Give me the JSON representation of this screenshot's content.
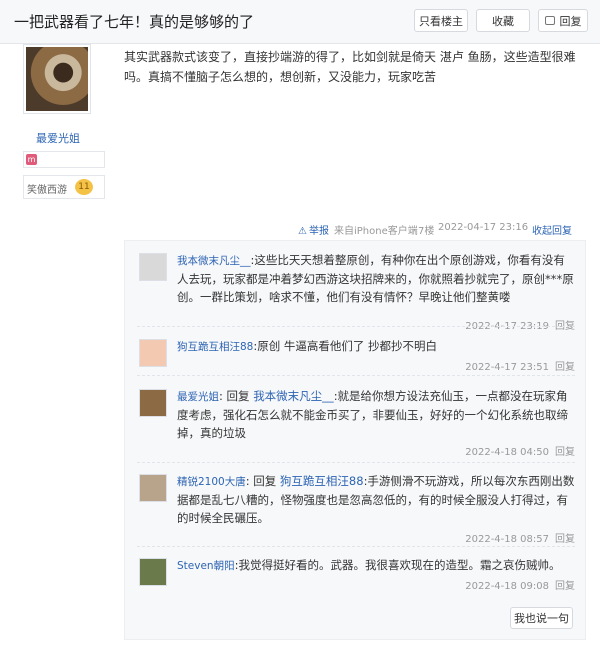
{
  "header": {
    "title": "一把武器看了七年！真的是够够的了",
    "btn_author_only": "只看楼主",
    "btn_collect": "收藏",
    "btn_reply": "回复"
  },
  "author": {
    "name": "最爱光姐",
    "level_name": "笑傲西游",
    "level_num": "11"
  },
  "post": {
    "text": "其实武器款式该变了，直接抄端游的得了，比如剑就是倚天 湛卢 鱼肠，这些造型很难吗。真搞不懂脑子怎么想的，想创新，又没能力，玩家吃苦",
    "report": "举报",
    "source": "来自iPhone客户端",
    "floor": "7楼",
    "time": "2022-04-17 23:16",
    "fold": "收起回复"
  },
  "replies": [
    {
      "user": "我本微末凡尘__",
      "prefix": ":",
      "target": "",
      "text": "这些比天天想着整原创，有种你在出个原创游戏，你看有没有人去玩，玩家都是冲着梦幻西游这块招牌来的，你就照着抄就完了，原创***原创。一群比策划，啥求不懂，他们有没有情怀？早晚让他们整黄喽",
      "time": "2022-4-17 23:19",
      "reply_label": "回复"
    },
    {
      "user": "狗互跪互相汪88",
      "prefix": ":",
      "target": "",
      "text": "原创 牛逼高看他们了 抄都抄不明白",
      "time": "2022-4-17 23:51",
      "reply_label": "回复"
    },
    {
      "user": "最爱光姐",
      "prefix": ": 回复 ",
      "target": "我本微末凡尘__",
      "text": ":就是给你想方设法充仙玉，一点都没在玩家角度考虑，强化石怎么就不能金币买了，非要仙玉，好好的一个幻化系统也取缔掉，真的垃圾",
      "time": "2022-4-18 04:50",
      "reply_label": "回复"
    },
    {
      "user": "精锐2100大唐",
      "prefix": ": 回复 ",
      "target": "狗互跪互相汪88",
      "text": ":手游侧滑不玩游戏，所以每次东西刚出数据都是乱七八糟的，怪物强度也是忽高忽低的，有的时候全服没人打得过，有的时候全民碾压。",
      "time": "2022-4-18 08:57",
      "reply_label": "回复"
    },
    {
      "user": "Steven朝阳",
      "prefix": ":",
      "target": "",
      "text": "我觉得挺好看的。武器。我很喜欢现在的造型。霜之哀伤贼帅。",
      "time": "2022-4-18 09:08",
      "reply_label": "回复"
    }
  ],
  "say_button": "我也说一句",
  "colors": {
    "link": "#2d64b3",
    "muted": "#999999",
    "panel": "#f7f8fa"
  }
}
